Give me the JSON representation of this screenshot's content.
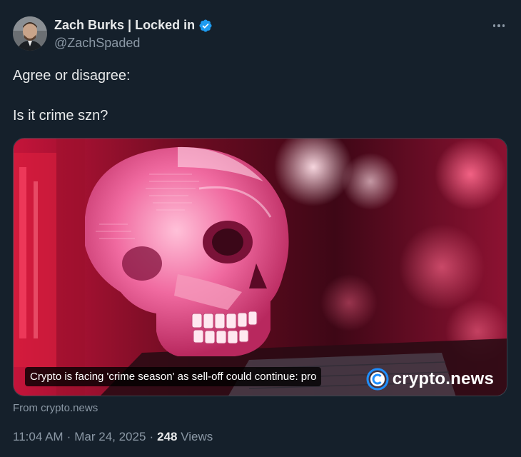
{
  "author": {
    "display_name": "Zach Burks | Locked in",
    "handle": "@ZachSpaded",
    "verified": true,
    "verified_color": "#1d9bf0"
  },
  "tweet": {
    "lines": [
      "Agree or disagree:",
      "Is it crime szn?"
    ]
  },
  "card": {
    "caption": "Crypto is facing 'crime season' as sell-off could continue: pro",
    "watermark": "crypto.news",
    "source": "From crypto.news"
  },
  "meta": {
    "time": "11:04 AM",
    "date": "Mar 24, 2025",
    "view_count": "248",
    "view_label": "Views"
  },
  "icons": {
    "more": "more-horizontal-icon",
    "verified": "verified-badge-icon",
    "watermark_logo": "crypto-news-logo-icon"
  },
  "colors": {
    "background": "#15202b",
    "primary_text": "#e7e9ea",
    "secondary_text": "#8b98a5",
    "accent": "#1d9bf0"
  }
}
